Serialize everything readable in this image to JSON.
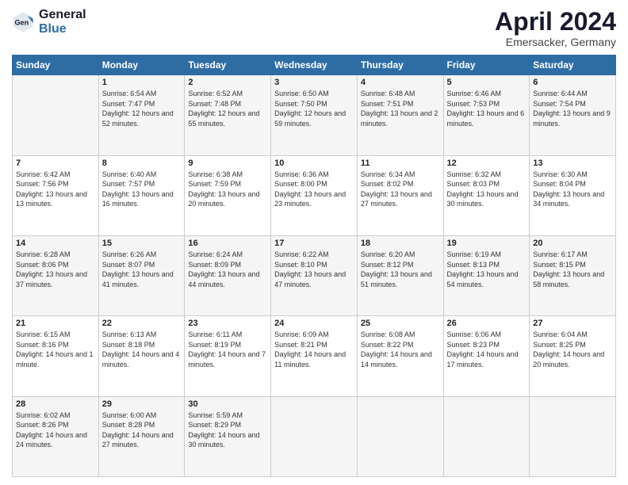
{
  "logo": {
    "general": "General",
    "blue": "Blue"
  },
  "header": {
    "month": "April 2024",
    "location": "Emersacker, Germany"
  },
  "weekdays": [
    "Sunday",
    "Monday",
    "Tuesday",
    "Wednesday",
    "Thursday",
    "Friday",
    "Saturday"
  ],
  "weeks": [
    [
      {
        "num": "",
        "sunrise": "",
        "sunset": "",
        "daylight": ""
      },
      {
        "num": "1",
        "sunrise": "Sunrise: 6:54 AM",
        "sunset": "Sunset: 7:47 PM",
        "daylight": "Daylight: 12 hours and 52 minutes."
      },
      {
        "num": "2",
        "sunrise": "Sunrise: 6:52 AM",
        "sunset": "Sunset: 7:48 PM",
        "daylight": "Daylight: 12 hours and 55 minutes."
      },
      {
        "num": "3",
        "sunrise": "Sunrise: 6:50 AM",
        "sunset": "Sunset: 7:50 PM",
        "daylight": "Daylight: 12 hours and 59 minutes."
      },
      {
        "num": "4",
        "sunrise": "Sunrise: 6:48 AM",
        "sunset": "Sunset: 7:51 PM",
        "daylight": "Daylight: 13 hours and 2 minutes."
      },
      {
        "num": "5",
        "sunrise": "Sunrise: 6:46 AM",
        "sunset": "Sunset: 7:53 PM",
        "daylight": "Daylight: 13 hours and 6 minutes."
      },
      {
        "num": "6",
        "sunrise": "Sunrise: 6:44 AM",
        "sunset": "Sunset: 7:54 PM",
        "daylight": "Daylight: 13 hours and 9 minutes."
      }
    ],
    [
      {
        "num": "7",
        "sunrise": "Sunrise: 6:42 AM",
        "sunset": "Sunset: 7:56 PM",
        "daylight": "Daylight: 13 hours and 13 minutes."
      },
      {
        "num": "8",
        "sunrise": "Sunrise: 6:40 AM",
        "sunset": "Sunset: 7:57 PM",
        "daylight": "Daylight: 13 hours and 16 minutes."
      },
      {
        "num": "9",
        "sunrise": "Sunrise: 6:38 AM",
        "sunset": "Sunset: 7:59 PM",
        "daylight": "Daylight: 13 hours and 20 minutes."
      },
      {
        "num": "10",
        "sunrise": "Sunrise: 6:36 AM",
        "sunset": "Sunset: 8:00 PM",
        "daylight": "Daylight: 13 hours and 23 minutes."
      },
      {
        "num": "11",
        "sunrise": "Sunrise: 6:34 AM",
        "sunset": "Sunset: 8:02 PM",
        "daylight": "Daylight: 13 hours and 27 minutes."
      },
      {
        "num": "12",
        "sunrise": "Sunrise: 6:32 AM",
        "sunset": "Sunset: 8:03 PM",
        "daylight": "Daylight: 13 hours and 30 minutes."
      },
      {
        "num": "13",
        "sunrise": "Sunrise: 6:30 AM",
        "sunset": "Sunset: 8:04 PM",
        "daylight": "Daylight: 13 hours and 34 minutes."
      }
    ],
    [
      {
        "num": "14",
        "sunrise": "Sunrise: 6:28 AM",
        "sunset": "Sunset: 8:06 PM",
        "daylight": "Daylight: 13 hours and 37 minutes."
      },
      {
        "num": "15",
        "sunrise": "Sunrise: 6:26 AM",
        "sunset": "Sunset: 8:07 PM",
        "daylight": "Daylight: 13 hours and 41 minutes."
      },
      {
        "num": "16",
        "sunrise": "Sunrise: 6:24 AM",
        "sunset": "Sunset: 8:09 PM",
        "daylight": "Daylight: 13 hours and 44 minutes."
      },
      {
        "num": "17",
        "sunrise": "Sunrise: 6:22 AM",
        "sunset": "Sunset: 8:10 PM",
        "daylight": "Daylight: 13 hours and 47 minutes."
      },
      {
        "num": "18",
        "sunrise": "Sunrise: 6:20 AM",
        "sunset": "Sunset: 8:12 PM",
        "daylight": "Daylight: 13 hours and 51 minutes."
      },
      {
        "num": "19",
        "sunrise": "Sunrise: 6:19 AM",
        "sunset": "Sunset: 8:13 PM",
        "daylight": "Daylight: 13 hours and 54 minutes."
      },
      {
        "num": "20",
        "sunrise": "Sunrise: 6:17 AM",
        "sunset": "Sunset: 8:15 PM",
        "daylight": "Daylight: 13 hours and 58 minutes."
      }
    ],
    [
      {
        "num": "21",
        "sunrise": "Sunrise: 6:15 AM",
        "sunset": "Sunset: 8:16 PM",
        "daylight": "Daylight: 14 hours and 1 minute."
      },
      {
        "num": "22",
        "sunrise": "Sunrise: 6:13 AM",
        "sunset": "Sunset: 8:18 PM",
        "daylight": "Daylight: 14 hours and 4 minutes."
      },
      {
        "num": "23",
        "sunrise": "Sunrise: 6:11 AM",
        "sunset": "Sunset: 8:19 PM",
        "daylight": "Daylight: 14 hours and 7 minutes."
      },
      {
        "num": "24",
        "sunrise": "Sunrise: 6:09 AM",
        "sunset": "Sunset: 8:21 PM",
        "daylight": "Daylight: 14 hours and 11 minutes."
      },
      {
        "num": "25",
        "sunrise": "Sunrise: 6:08 AM",
        "sunset": "Sunset: 8:22 PM",
        "daylight": "Daylight: 14 hours and 14 minutes."
      },
      {
        "num": "26",
        "sunrise": "Sunrise: 6:06 AM",
        "sunset": "Sunset: 8:23 PM",
        "daylight": "Daylight: 14 hours and 17 minutes."
      },
      {
        "num": "27",
        "sunrise": "Sunrise: 6:04 AM",
        "sunset": "Sunset: 8:25 PM",
        "daylight": "Daylight: 14 hours and 20 minutes."
      }
    ],
    [
      {
        "num": "28",
        "sunrise": "Sunrise: 6:02 AM",
        "sunset": "Sunset: 8:26 PM",
        "daylight": "Daylight: 14 hours and 24 minutes."
      },
      {
        "num": "29",
        "sunrise": "Sunrise: 6:00 AM",
        "sunset": "Sunset: 8:28 PM",
        "daylight": "Daylight: 14 hours and 27 minutes."
      },
      {
        "num": "30",
        "sunrise": "Sunrise: 5:59 AM",
        "sunset": "Sunset: 8:29 PM",
        "daylight": "Daylight: 14 hours and 30 minutes."
      },
      {
        "num": "",
        "sunrise": "",
        "sunset": "",
        "daylight": ""
      },
      {
        "num": "",
        "sunrise": "",
        "sunset": "",
        "daylight": ""
      },
      {
        "num": "",
        "sunrise": "",
        "sunset": "",
        "daylight": ""
      },
      {
        "num": "",
        "sunrise": "",
        "sunset": "",
        "daylight": ""
      }
    ]
  ]
}
